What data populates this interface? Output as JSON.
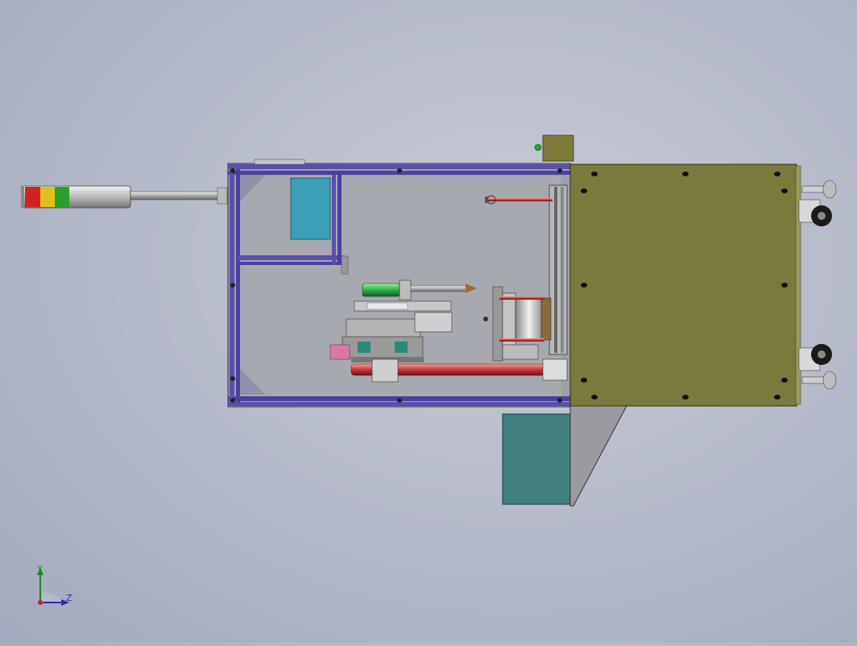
{
  "viewport": {
    "background_top": "#c9ccd6",
    "background_bottom": "#a3aabf"
  },
  "model": {
    "frame_color": "#5a4fb0",
    "panel_color": "#7a7a3c",
    "inner_color": "#9ea0a8",
    "tank_color": "#3f7f7f",
    "cyan_plate_color": "#3aa0b8",
    "rod_color": "#c43a3a",
    "cylinder_color": "#2fb04a",
    "signal_tower": {
      "segments": [
        "#d42020",
        "#e0c020",
        "#2aa02a"
      ]
    }
  },
  "triad": {
    "y_label": "Y",
    "z_label": "Z"
  }
}
